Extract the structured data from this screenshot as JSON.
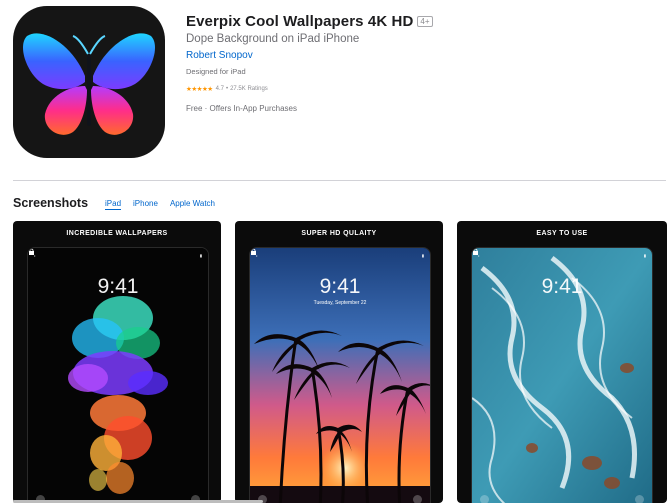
{
  "app": {
    "title": "Everpix Cool Wallpapers 4K HD",
    "age_rating": "4+",
    "subtitle": "Dope Background on iPad iPhone",
    "developer": "Robert Snopov",
    "designed_for": "Designed for iPad",
    "stars": "★★★★★",
    "rating": "4.7",
    "separator": "•",
    "ratings_count": "27.5K Ratings",
    "price": "Free · Offers In-App Purchases",
    "icon": "butterfly-icon"
  },
  "screenshots": {
    "title": "Screenshots",
    "tabs": [
      {
        "label": "iPad",
        "active": true
      },
      {
        "label": "iPhone",
        "active": false
      },
      {
        "label": "Apple Watch",
        "active": false
      }
    ],
    "items": [
      {
        "caption": "INCREDIBLE WALLPAPERS",
        "time": "9:41",
        "date": "",
        "theme": "ink-splash"
      },
      {
        "caption": "SUPER HD QULAITY",
        "time": "9:41",
        "date": "Tuesday, September 22",
        "theme": "palm-sunset"
      },
      {
        "caption": "EASY TO USE",
        "time": "9:41",
        "date": "",
        "theme": "ocean-aerial"
      }
    ]
  },
  "colors": {
    "link": "#0066cc",
    "star": "#ff9500",
    "background": "#ffffff"
  }
}
